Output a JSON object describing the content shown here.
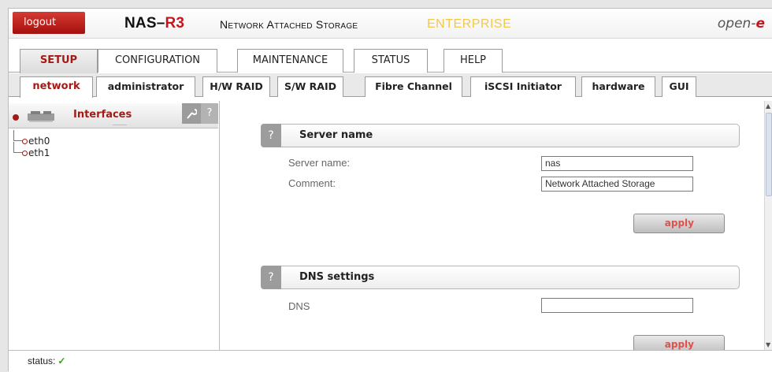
{
  "header": {
    "logout_label": "logout",
    "brand_prefix": "NAS–",
    "brand_suffix": "R3",
    "subtitle": "Network Attached Storage",
    "edition": "ENTERPRISE",
    "logo_text": "open-",
    "logo_e": "e"
  },
  "main_tabs": [
    "SETUP",
    "CONFIGURATION",
    "MAINTENANCE",
    "STATUS",
    "HELP"
  ],
  "sub_tabs": [
    "network",
    "administrator",
    "H/W RAID",
    "S/W RAID",
    "Fibre Channel",
    "iSCSI Initiator",
    "hardware",
    "GUI"
  ],
  "sidebar": {
    "title": "Interfaces",
    "help_label": "?",
    "items": [
      "eth0",
      "eth1"
    ]
  },
  "server_name": {
    "help_label": "?",
    "title": "Server name",
    "server_label": "Server name:",
    "server_value": "nas",
    "comment_label": "Comment:",
    "comment_value": "Network Attached Storage",
    "apply_label": "apply"
  },
  "dns": {
    "help_label": "?",
    "title": "DNS settings",
    "dns_label": "DNS",
    "dns_value": "",
    "apply_label": "apply"
  },
  "status": {
    "label": "status:",
    "icon": "check-icon"
  },
  "colors": {
    "accent_red": "#a31b16",
    "logout_red": "#c4161c",
    "edition_yellow": "#f2c84b",
    "status_green": "#3a9a22"
  }
}
